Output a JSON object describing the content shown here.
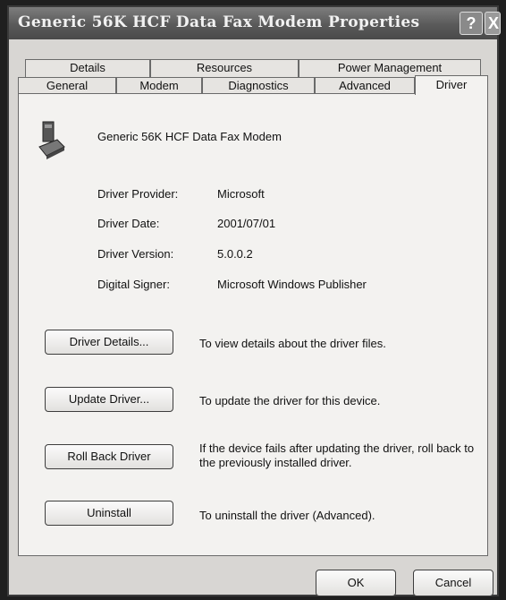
{
  "window": {
    "title": "Generic 56K HCF Data Fax Modem Properties"
  },
  "titlebar_buttons": {
    "help": "?",
    "close": "X"
  },
  "tabs_row1": [
    "Details",
    "Resources",
    "Power Management"
  ],
  "tabs_row2": [
    "General",
    "Modem",
    "Diagnostics",
    "Advanced",
    "Driver"
  ],
  "active_tab": "Driver",
  "device": {
    "name": "Generic 56K HCF Data Fax Modem",
    "icon": "modem-icon"
  },
  "info": [
    {
      "label": "Driver Provider:",
      "value": "Microsoft"
    },
    {
      "label": "Driver Date:",
      "value": "2001/07/01"
    },
    {
      "label": "Driver Version:",
      "value": "5.0.0.2"
    },
    {
      "label": "Digital Signer:",
      "value": "Microsoft Windows Publisher"
    }
  ],
  "actions": [
    {
      "button": "Driver Details...",
      "description": "To view details about the driver files."
    },
    {
      "button": "Update Driver...",
      "description": "To update the driver for this device."
    },
    {
      "button": "Roll Back Driver",
      "description": "If the device fails after updating the driver, roll back to the previously installed driver."
    },
    {
      "button": "Uninstall",
      "description": "To uninstall the driver (Advanced)."
    }
  ],
  "footer": {
    "ok": "OK",
    "cancel": "Cancel"
  }
}
